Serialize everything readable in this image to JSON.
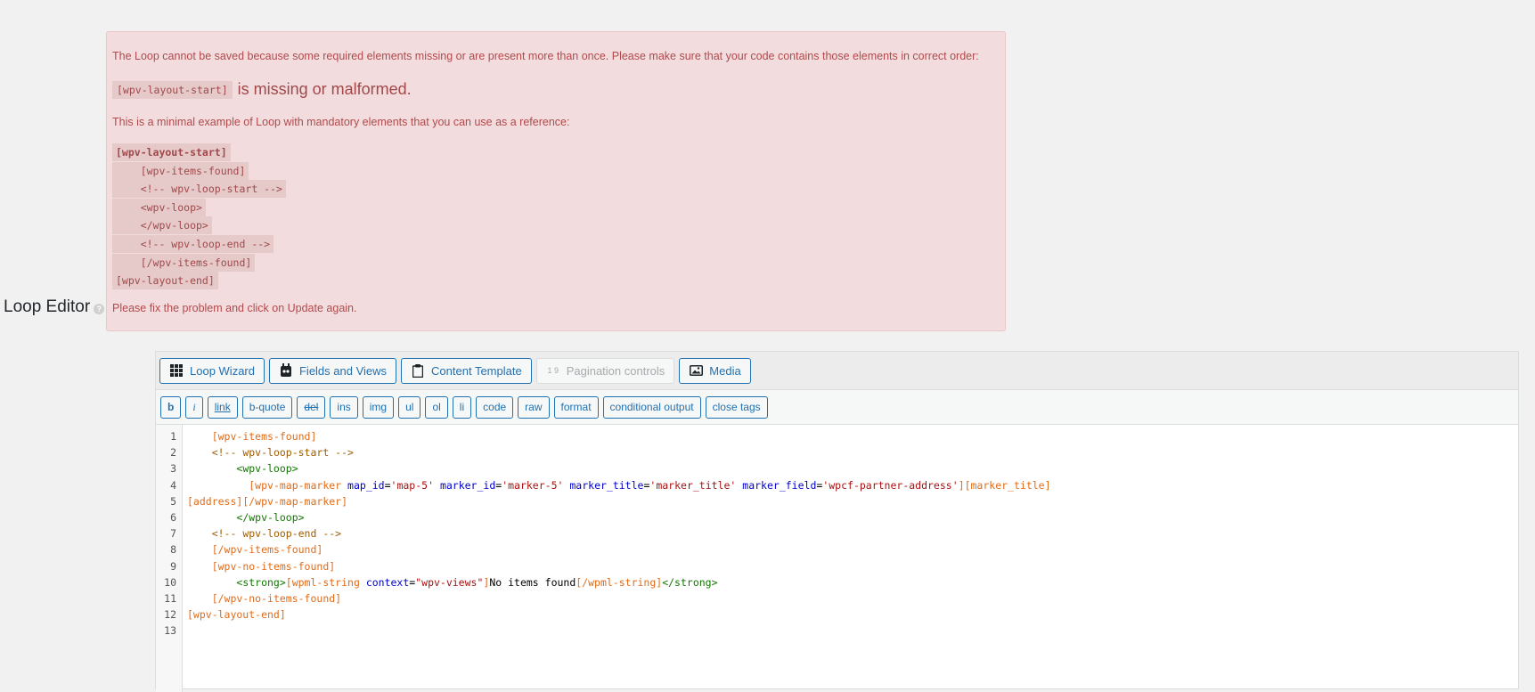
{
  "loop_editor": {
    "label": "Loop Editor",
    "help_icon": "question-icon"
  },
  "error": {
    "message": "The Loop cannot be saved because some required elements missing or are present more than once. Please make sure that your code contains those elements in correct order:",
    "missing_tag": "[wpv-layout-start]",
    "missing_text": "is missing or malformed.",
    "example_intro": "This is a minimal example of Loop with mandatory elements that you can use as a reference:",
    "example_lines": [
      "[wpv-layout-start]",
      "    [wpv-items-found]",
      "    <!-- wpv-loop-start -->",
      "    <wpv-loop>",
      "    </wpv-loop>",
      "    <!-- wpv-loop-end -->",
      "    [/wpv-items-found]",
      "[wpv-layout-end]"
    ],
    "fix_text": "Please fix the problem and click on Update again."
  },
  "toolbar": {
    "buttons": [
      {
        "label": "Loop Wizard",
        "icon": "grid-icon"
      },
      {
        "label": "Fields and Views",
        "icon": "views-icon"
      },
      {
        "label": "Content Template",
        "icon": "clipboard-icon"
      },
      {
        "label": "Pagination controls",
        "icon": "pagination-icon",
        "icon_text": "1 9",
        "disabled": true
      },
      {
        "label": "Media",
        "icon": "image-icon"
      }
    ]
  },
  "quicktags": [
    "b",
    "i",
    "link",
    "b-quote",
    "del",
    "ins",
    "img",
    "ul",
    "ol",
    "li",
    "code",
    "raw",
    "format",
    "conditional output",
    "close tags"
  ],
  "code": {
    "line_numbers": [
      "1",
      "2",
      "3",
      "4",
      "5",
      "6",
      "7",
      "8",
      "9",
      "10",
      "11",
      "12",
      "13"
    ],
    "lines": [
      "    [wpv-items-found]",
      "    <!-- wpv-loop-start -->",
      "        <wpv-loop>",
      "          [wpv-map-marker map_id='map-5' marker_id='marker-5' marker_title='marker_title' marker_field='wpcf-partner-address'][marker_title]",
      "[address][/wpv-map-marker]",
      "        </wpv-loop>",
      "    <!-- wpv-loop-end -->",
      "    [/wpv-items-found]",
      "    [wpv-no-items-found]",
      "        <strong>[wpml-string context=\"wpv-views\"]No items found[/wpml-string]</strong>",
      "    [/wpv-no-items-found]",
      "[wpv-layout-end]",
      ""
    ]
  },
  "colors": {
    "error_bg": "#f3dcdd",
    "error_text": "#b14a4d",
    "button_accent": "#2271b1",
    "shortcode": "#e06c1a",
    "html_tag": "#117700",
    "attribute": "#0000cc",
    "string": "#aa1111"
  }
}
